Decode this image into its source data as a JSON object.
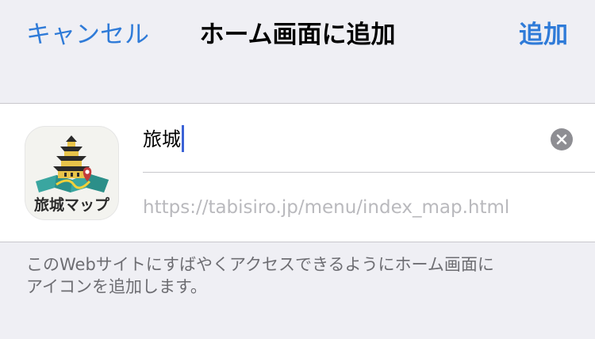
{
  "nav": {
    "cancel_label": "キャンセル",
    "title": "ホーム画面に追加",
    "add_label": "追加"
  },
  "app": {
    "icon_label": "旅城マップ",
    "name_value": "旅城",
    "url": "https://tabisiro.jp/menu/index_map.html"
  },
  "footer": {
    "line1": "このWebサイトにすばやくアクセスできるようにホーム画面に",
    "line2": "アイコンを追加します。"
  },
  "colors": {
    "accent": "#2f7bd8",
    "background": "#efeff4",
    "caret": "#3b62d6"
  },
  "icons": {
    "clear": "clear-icon",
    "app": "castle-map-icon"
  }
}
